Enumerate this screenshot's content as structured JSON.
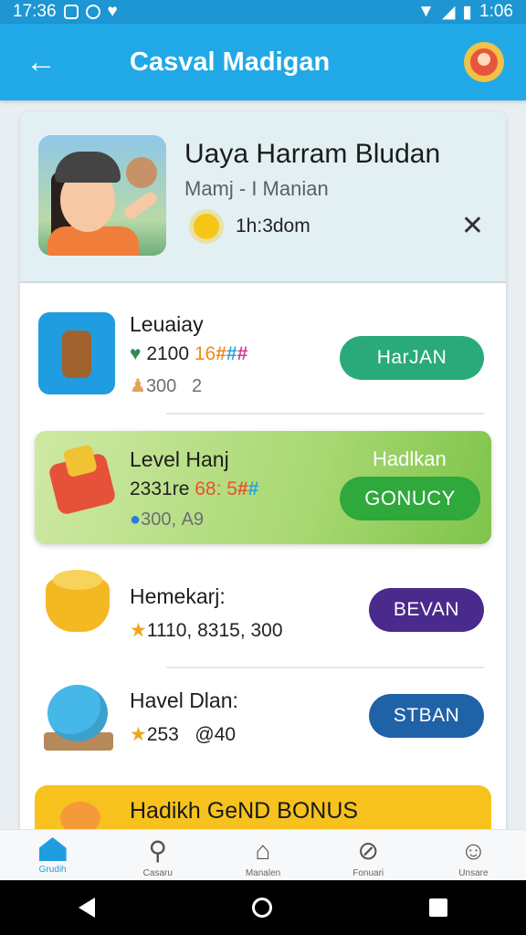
{
  "status_bar": {
    "time": "17:36",
    "right_time": "1:06"
  },
  "app_bar": {
    "title": "Casval Madigan"
  },
  "profile": {
    "name": "Uaya Harram Bludan",
    "subtitle": "Mamj - I Manian",
    "stat": "1h:3dom"
  },
  "rows": [
    {
      "title": "Leuaiay",
      "stats_main": "2100",
      "stats_hash": "16",
      "sub_a": "300",
      "sub_b": "2",
      "button": "HarJAN",
      "button_color": "#2aaa7a"
    },
    {
      "title": "Level Hanj",
      "stats_main": "2331re",
      "stats_hash": "68: 5",
      "sub_a": "300,",
      "sub_b": "A9",
      "button": "GONUCY",
      "button_color": "#2fa83c",
      "banner_label": "Hadlkan"
    },
    {
      "title": "Hemekarj:",
      "stats_main": "1110,",
      "stats_extra": "8315, 300",
      "button": "BEVAN",
      "button_color": "#4a2a8c"
    },
    {
      "title": "Havel Dlan:",
      "stats_main": "253",
      "stats_extra": "@40",
      "button": "STBAN",
      "button_color": "#1f62a8"
    }
  ],
  "bonus": {
    "label": "Hadikh GeND BONUS"
  },
  "nav": [
    {
      "label": "Grudih",
      "icon": "home-icon"
    },
    {
      "label": "Casaru",
      "icon": "search-icon"
    },
    {
      "label": "Manalen",
      "icon": "building-icon"
    },
    {
      "label": "Fonuari",
      "icon": "shield-icon"
    },
    {
      "label": "Unsare",
      "icon": "person-icon"
    }
  ]
}
